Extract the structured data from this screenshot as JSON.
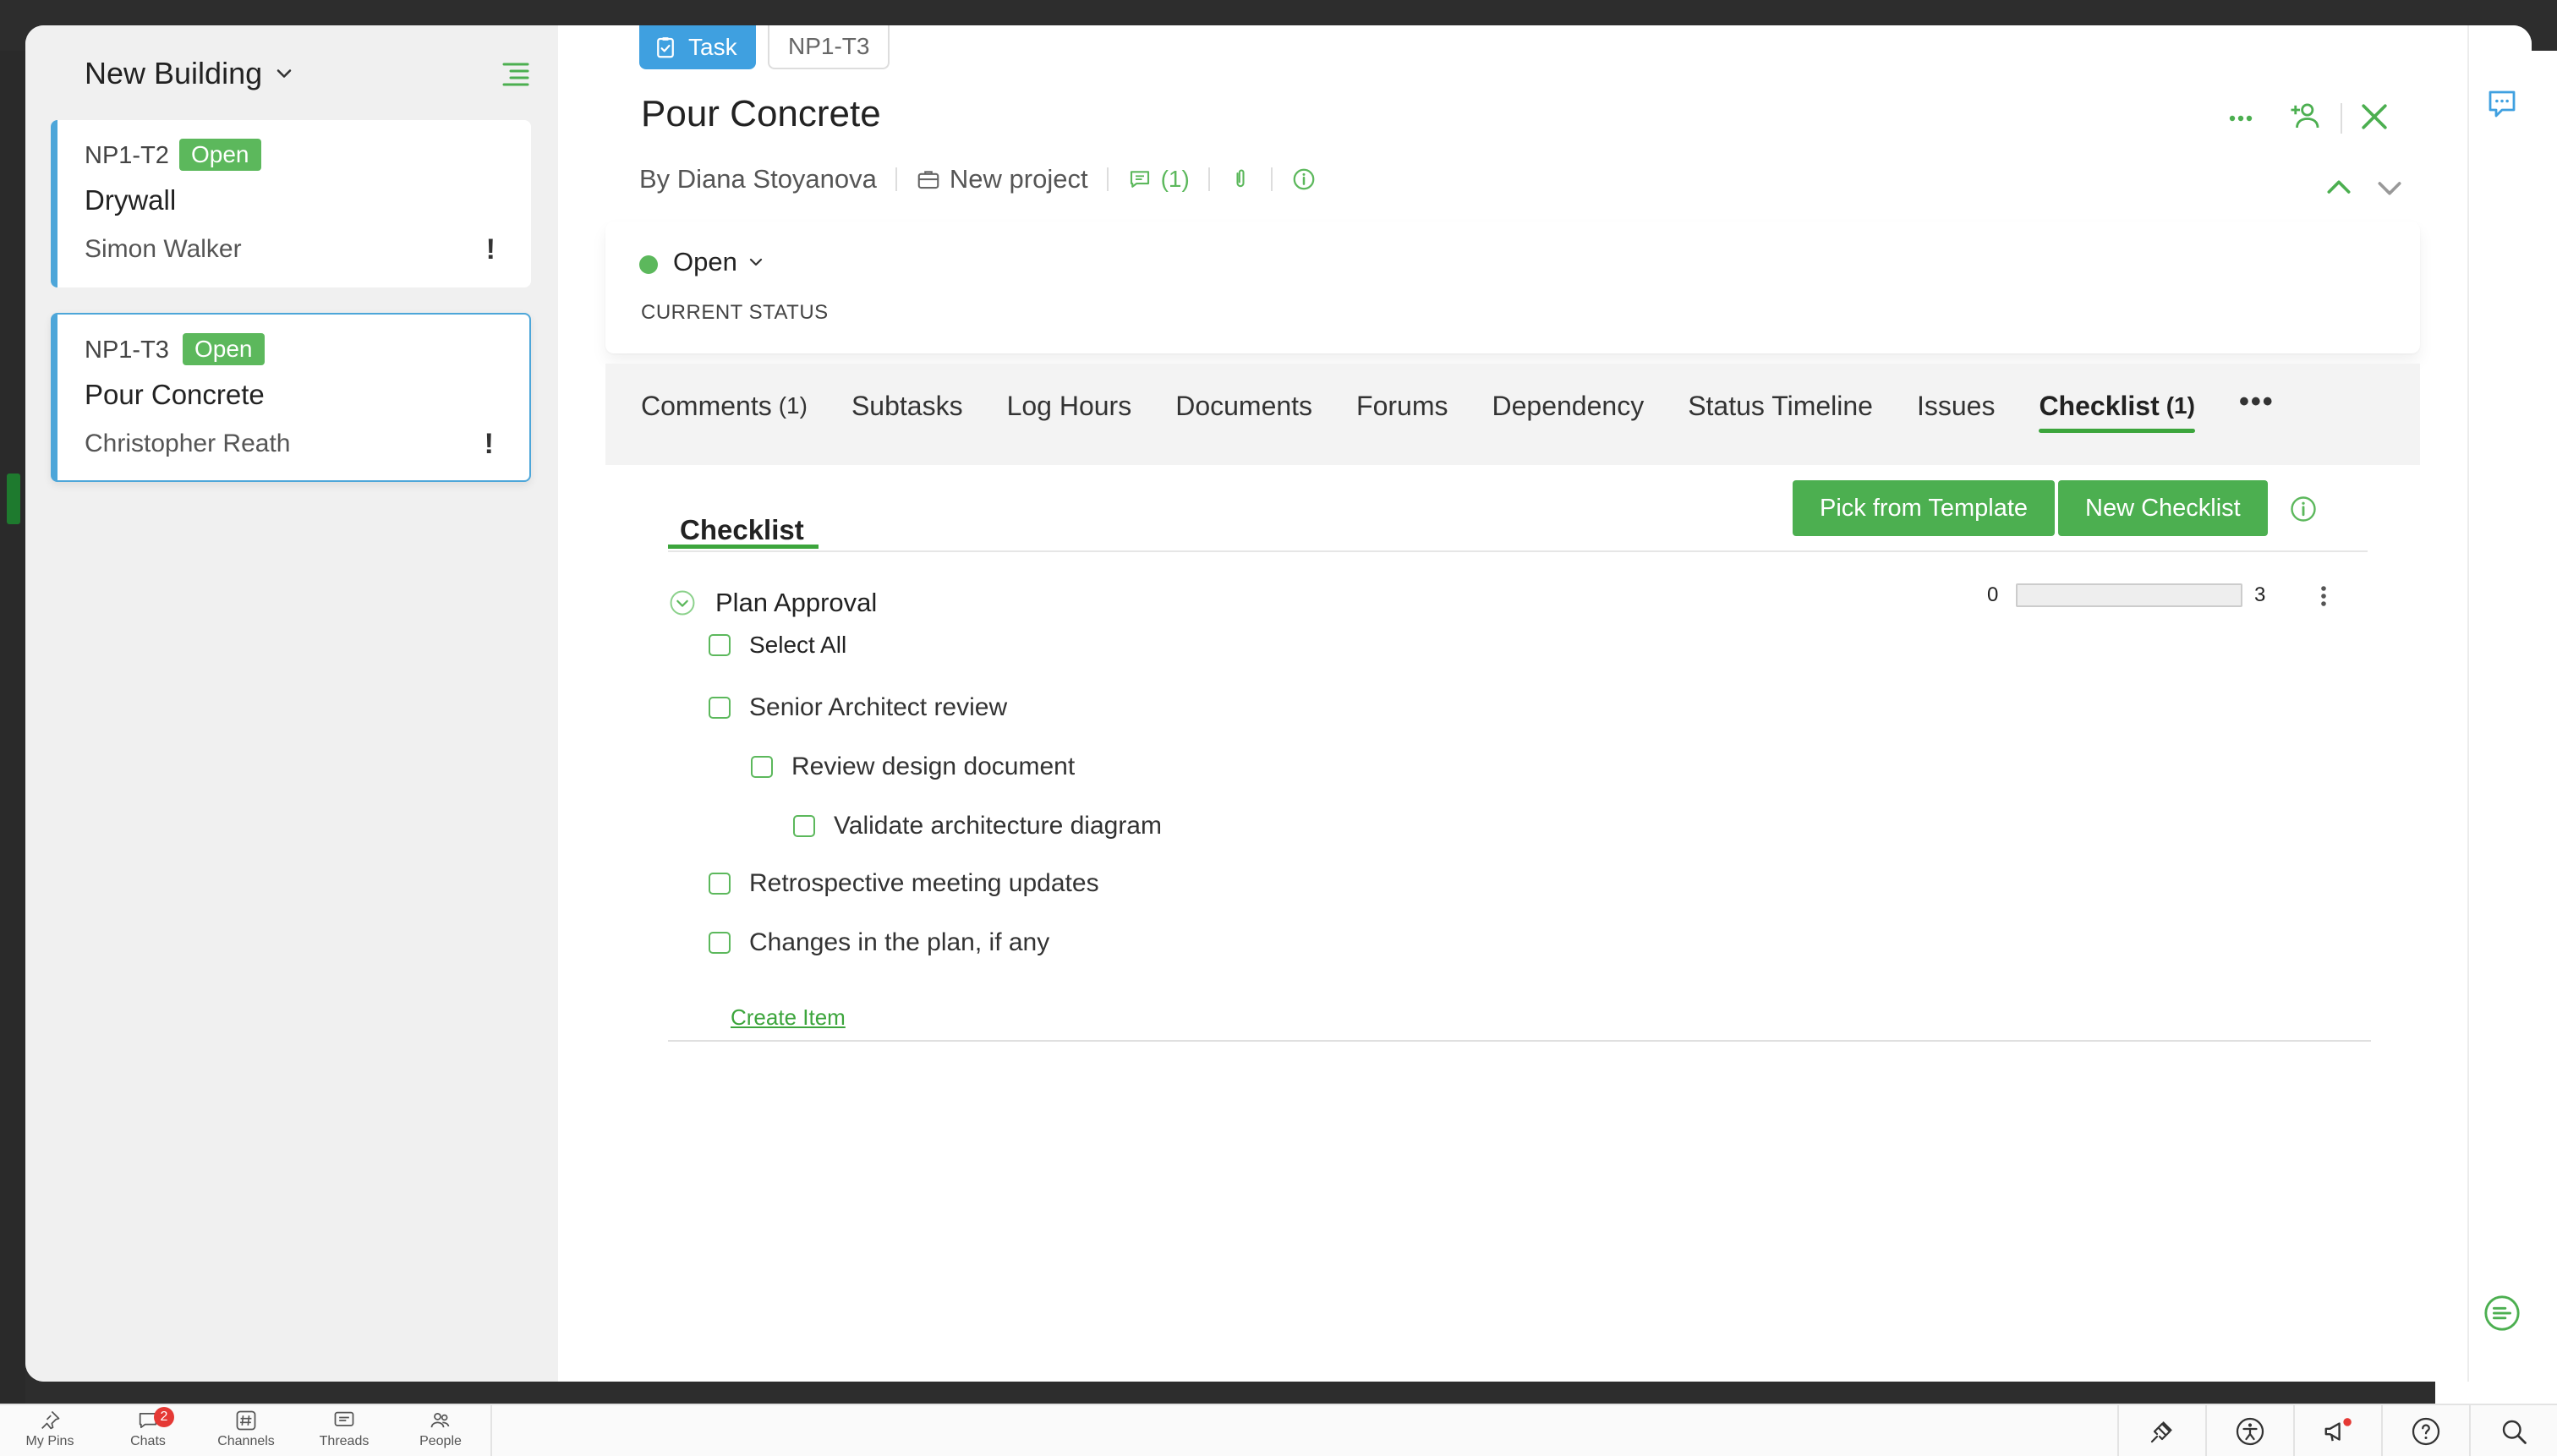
{
  "sidebar": {
    "project_title": "New Building",
    "tasks": [
      {
        "id": "NP1-T2",
        "status": "Open",
        "title": "Drywall",
        "owner": "Simon Walker",
        "priority": "!"
      },
      {
        "id": "NP1-T3",
        "status": "Open",
        "title": "Pour Concrete",
        "owner": "Christopher Reath",
        "priority": "!"
      }
    ]
  },
  "header": {
    "type_label": "Task",
    "task_id": "NP1-T3",
    "title": "Pour Concrete",
    "by": "By Diana Stoyanova",
    "project": "New project",
    "comment_count": "(1)"
  },
  "status": {
    "value": "Open",
    "caption": "CURRENT STATUS",
    "color": "#5cb85c"
  },
  "tabs": [
    {
      "label": "Comments",
      "count": "(1)"
    },
    {
      "label": "Subtasks",
      "count": ""
    },
    {
      "label": "Log Hours",
      "count": ""
    },
    {
      "label": "Documents",
      "count": ""
    },
    {
      "label": "Forums",
      "count": ""
    },
    {
      "label": "Dependency",
      "count": ""
    },
    {
      "label": "Status Timeline",
      "count": ""
    },
    {
      "label": "Issues",
      "count": ""
    },
    {
      "label": "Checklist",
      "count": "(1)"
    }
  ],
  "tab_more": "•••",
  "checklist": {
    "heading": "Checklist",
    "pick_button": "Pick from Template",
    "new_button": "New Checklist",
    "group": {
      "name": "Plan Approval",
      "progress_min": "0",
      "progress_max": "3",
      "progress_fraction": 0
    },
    "select_all": "Select All",
    "items": [
      {
        "label": "Senior Architect review"
      },
      {
        "label": "Review design document"
      },
      {
        "label": "Validate architecture diagram"
      },
      {
        "label": "Retrospective meeting updates"
      },
      {
        "label": "Changes in the plan, if any"
      }
    ],
    "create_item": "Create Item"
  },
  "taskbar": {
    "items": [
      {
        "label": "My Pins",
        "icon": "pin-icon"
      },
      {
        "label": "Chats",
        "icon": "chat-icon",
        "badge": "2"
      },
      {
        "label": "Channels",
        "icon": "hash-icon"
      },
      {
        "label": "Threads",
        "icon": "threads-icon"
      },
      {
        "label": "People",
        "icon": "people-icon"
      }
    ]
  },
  "colors": {
    "accent_green": "#4caf50",
    "task_blue": "#3fa0e0",
    "card_border": "#4da6d9"
  }
}
